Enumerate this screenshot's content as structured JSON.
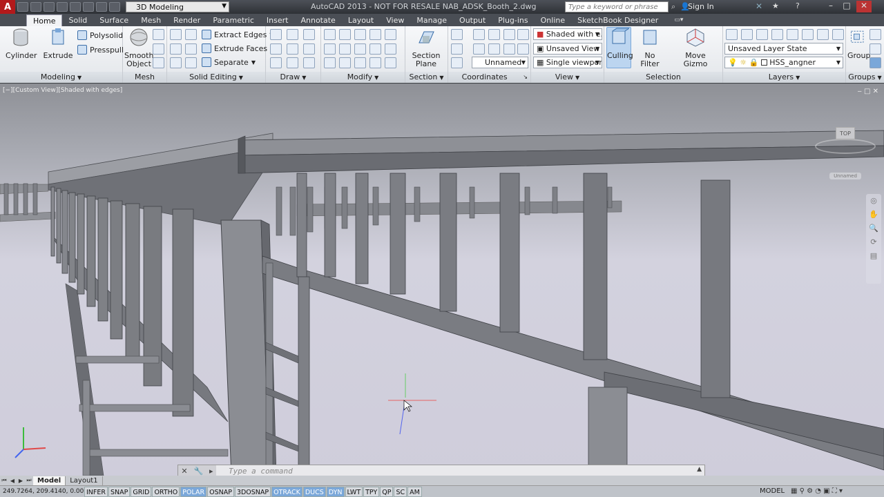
{
  "titlebar": {
    "logo": "A",
    "workspace": "3D Modeling",
    "window_title": "AutoCAD 2013 - NOT FOR RESALE    NAB_ADSK_Booth_2.dwg",
    "search_placeholder": "Type a keyword or phrase",
    "signin": "Sign In"
  },
  "tabs": [
    "Home",
    "Solid",
    "Surface",
    "Mesh",
    "Render",
    "Parametric",
    "Insert",
    "Annotate",
    "Layout",
    "View",
    "Manage",
    "Output",
    "Plug-ins",
    "Online",
    "SketchBook Designer"
  ],
  "ribbon": {
    "modeling": {
      "title": "Modeling",
      "cylinder": "Cylinder",
      "extrude": "Extrude",
      "polysolid": "Polysolid",
      "presspull": "Presspull"
    },
    "mesh": {
      "title": "Mesh",
      "smooth_object": "Smooth\nObject"
    },
    "solid_editing": {
      "title": "Solid Editing",
      "extract_edges": "Extract Edges",
      "extrude_faces": "Extrude Faces",
      "separate": "Separate"
    },
    "draw": {
      "title": "Draw"
    },
    "modify": {
      "title": "Modify"
    },
    "section": {
      "title": "Section",
      "section_plane": "Section\nPlane"
    },
    "coordinates": {
      "title": "Coordinates",
      "ucs_name": "Unnamed"
    },
    "view": {
      "title": "View",
      "visual_style": "Shaded with e...",
      "named_view": "Unsaved View",
      "viewport": "Single viewport"
    },
    "selection": {
      "title": "Selection",
      "culling": "Culling",
      "no_filter": "No Filter",
      "move_gizmo": "Move Gizmo"
    },
    "layers": {
      "title": "Layers",
      "layer_state": "Unsaved Layer State",
      "current_layer": "HSS_angner"
    },
    "groups": {
      "title": "Groups",
      "group": "Group"
    }
  },
  "viewport": {
    "label": "[−][Custom View][Shaded with edges]",
    "controls": "‒ □ ✕",
    "viewcube_face": "TOP",
    "ucs_menu": "Unnamed"
  },
  "command": {
    "placeholder": "Type a command"
  },
  "layout_tabs": [
    "Model",
    "Layout1"
  ],
  "status": {
    "coords": "249.7264, 209.4140, 0.0000",
    "toggles": [
      {
        "label": "INFER",
        "on": false
      },
      {
        "label": "SNAP",
        "on": false
      },
      {
        "label": "GRID",
        "on": false
      },
      {
        "label": "ORTHO",
        "on": false
      },
      {
        "label": "POLAR",
        "on": true
      },
      {
        "label": "OSNAP",
        "on": false
      },
      {
        "label": "3DOSNAP",
        "on": false
      },
      {
        "label": "OTRACK",
        "on": true
      },
      {
        "label": "DUCS",
        "on": true
      },
      {
        "label": "DYN",
        "on": true
      },
      {
        "label": "LWT",
        "on": false
      },
      {
        "label": "TPY",
        "on": false
      },
      {
        "label": "QP",
        "on": false
      },
      {
        "label": "SC",
        "on": false
      },
      {
        "label": "AM",
        "on": false
      }
    ],
    "model": "MODEL"
  }
}
